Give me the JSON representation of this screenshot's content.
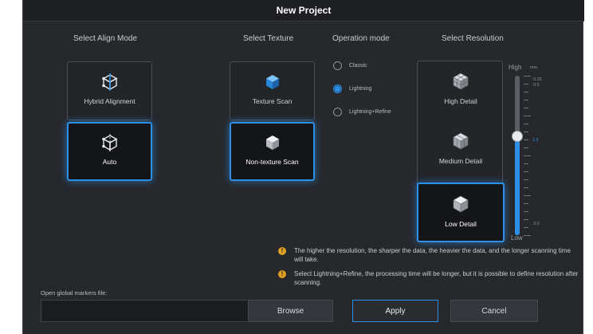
{
  "dialog": {
    "title": "New Project"
  },
  "align_mode": {
    "title": "Select Align Mode",
    "options": [
      {
        "label": "Hybrid Alignment",
        "icon": "hybrid-alignment-cube-icon",
        "selected": false
      },
      {
        "label": "Auto",
        "icon": "auto-align-cube-icon",
        "selected": true
      }
    ]
  },
  "texture": {
    "title": "Select Texture",
    "options": [
      {
        "label": "Texture Scan",
        "icon": "texture-cube-icon",
        "selected": false
      },
      {
        "label": "Non-texture Scan",
        "icon": "non-texture-cube-icon",
        "selected": true
      }
    ]
  },
  "operation_mode": {
    "title": "Operation mode",
    "options": [
      {
        "label": "Classic",
        "selected": false
      },
      {
        "label": "Lightning",
        "selected": true
      },
      {
        "label": "Lightning+Refine",
        "selected": false
      }
    ]
  },
  "resolution": {
    "title": "Select Resolution",
    "options": [
      {
        "label": "High Detail",
        "icon": "high-detail-mesh-icon",
        "selected": false
      },
      {
        "label": "Medium Detail",
        "icon": "medium-detail-mesh-icon",
        "selected": false
      },
      {
        "label": "Low Detail",
        "icon": "low-detail-mesh-icon",
        "selected": true
      }
    ],
    "slider": {
      "high_label": "High",
      "unit": "mm",
      "low_label": "Low",
      "top_value_1": "0.25",
      "top_value_2": "0.5",
      "current_value": "1.5",
      "bottom_value": "3.0",
      "level_fraction": 0.62
    }
  },
  "notes": [
    "The higher the resolution, the sharper the data, the heavier the data, and the longer scanning time will take.",
    "Select Lightning+Refine, the processing time will be longer, but it is possible to define resolution after scanning."
  ],
  "footer": {
    "markers_label": "Open global markers file:",
    "markers_value": "",
    "browse_label": "Browse",
    "apply_label": "Apply",
    "cancel_label": "Cancel"
  },
  "colors": {
    "accent": "#2e8fe6",
    "background": "#26282c",
    "warning": "#e0a020"
  }
}
